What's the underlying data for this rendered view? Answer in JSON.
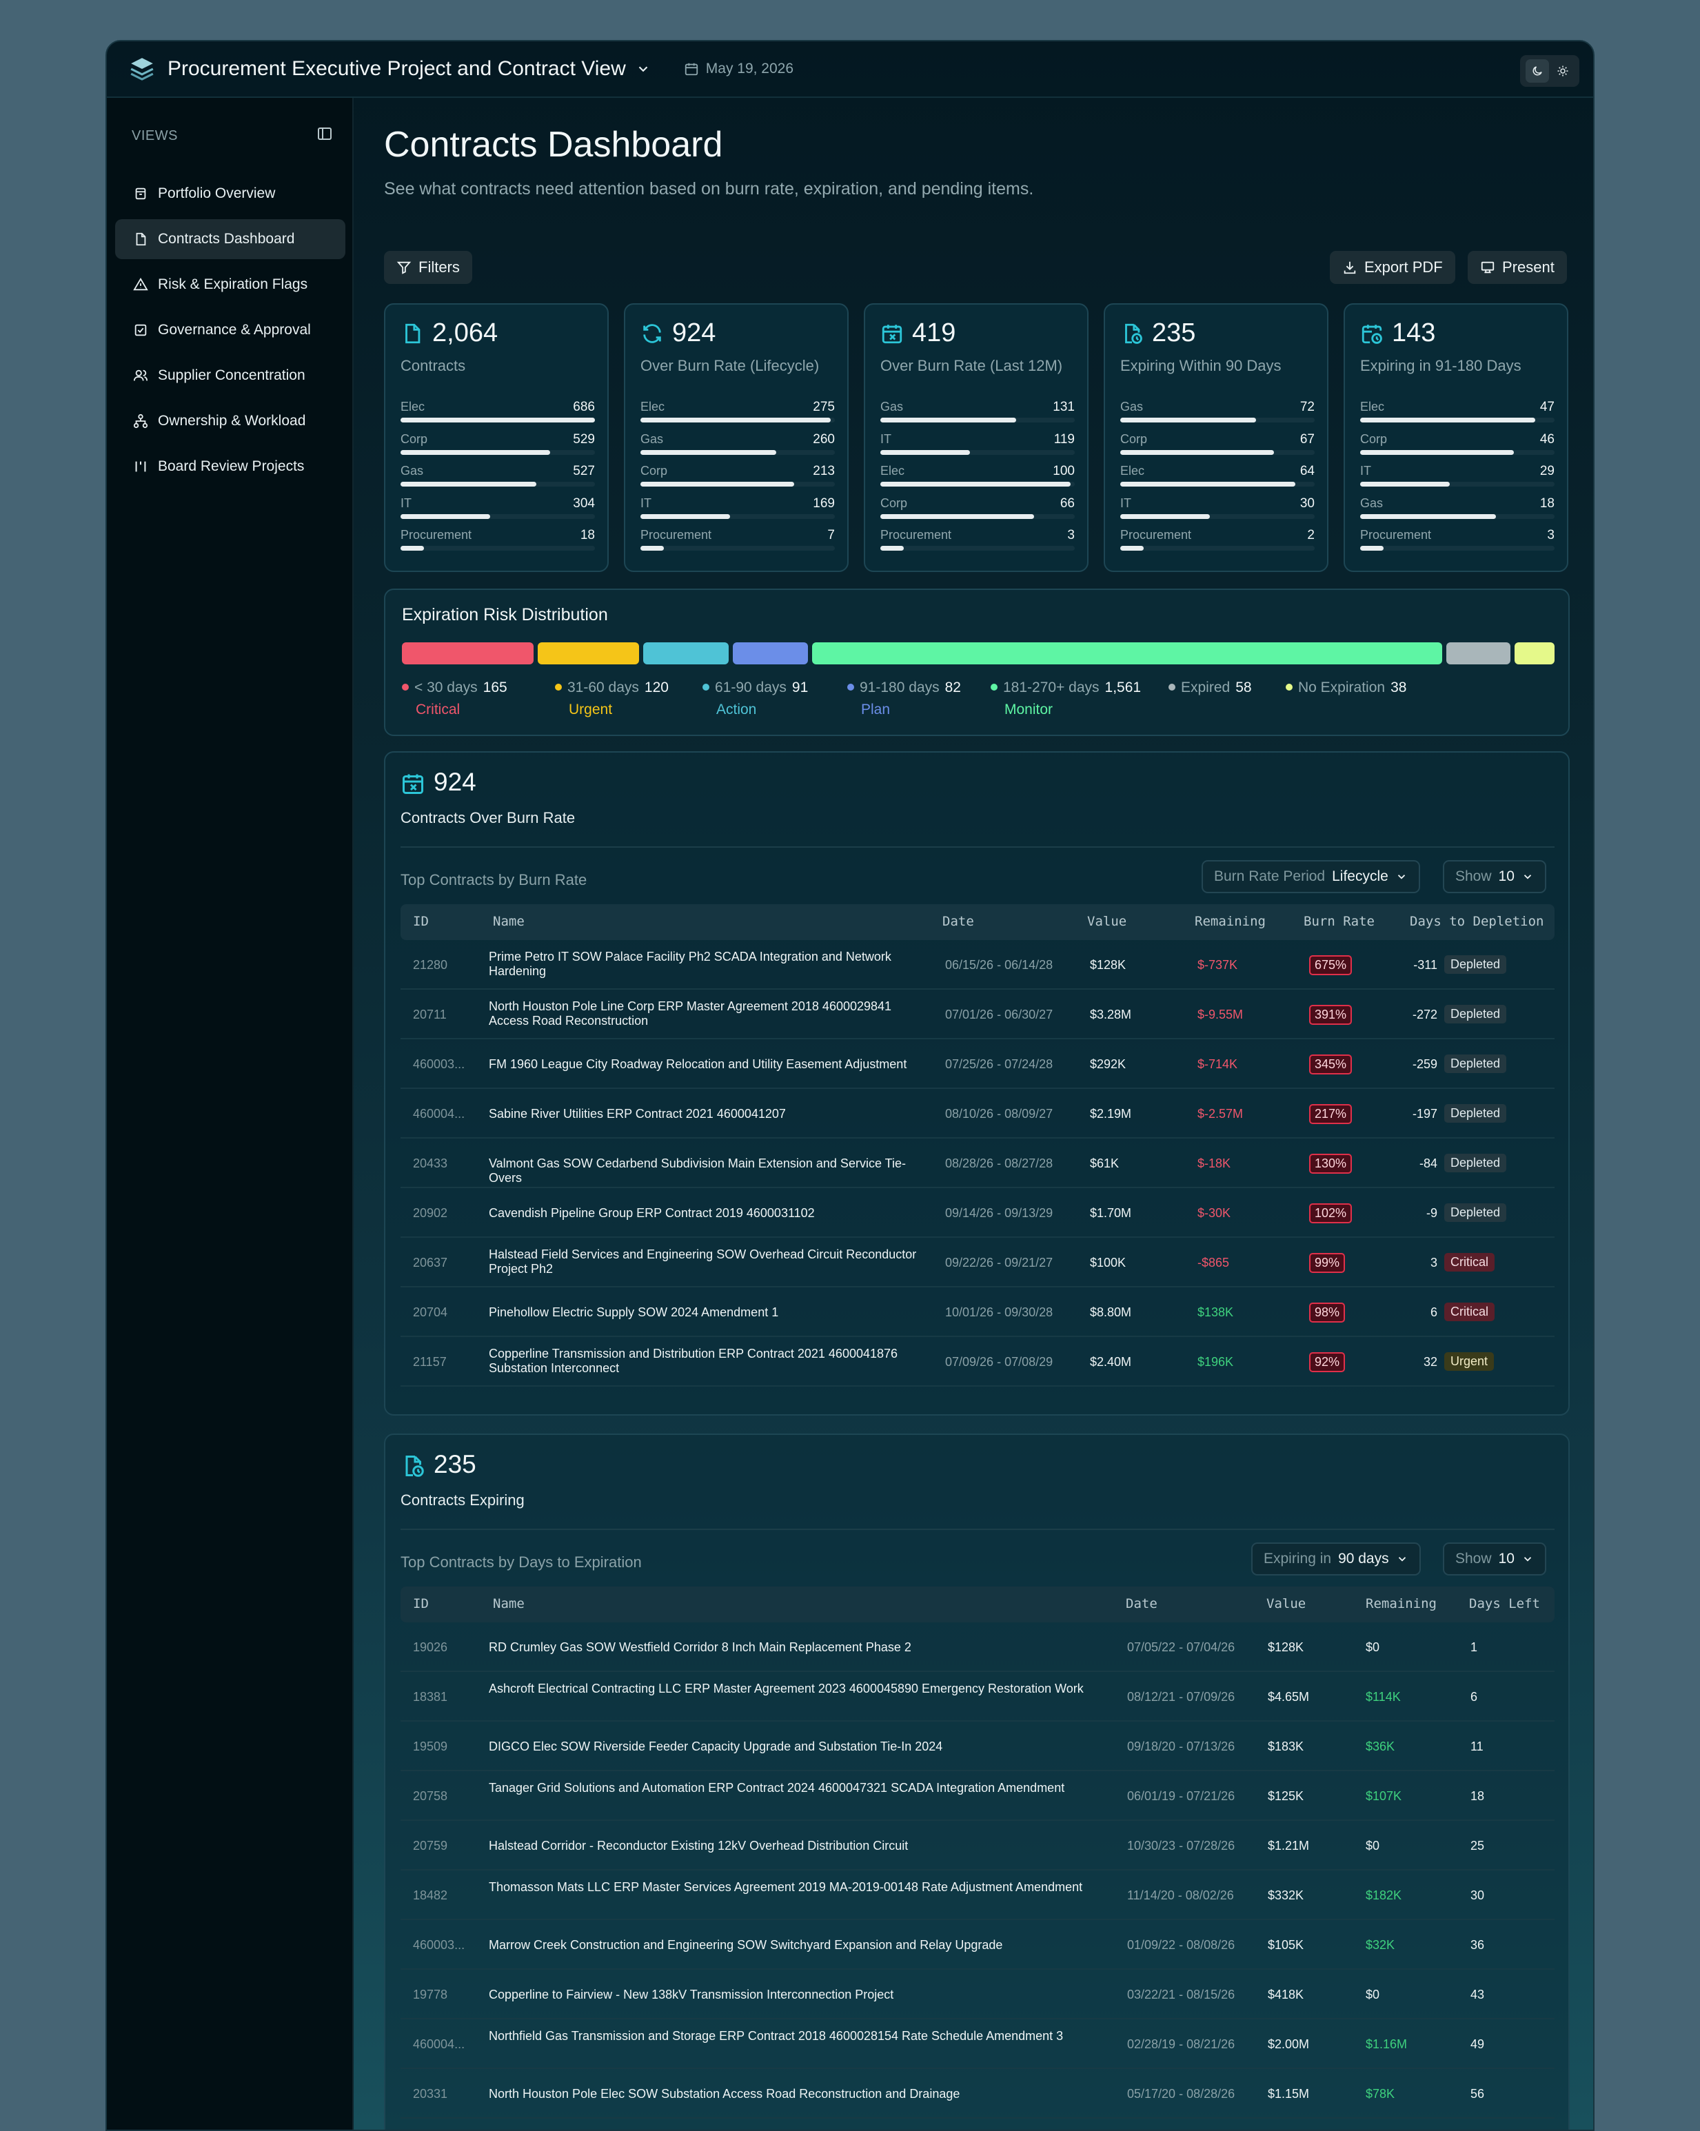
{
  "app": {
    "title": "Procurement Executive Project and Contract View",
    "date": "May 19, 2026"
  },
  "sidebar": {
    "heading": "VIEWS",
    "items": [
      {
        "label": "Portfolio Overview",
        "icon": "archive-icon"
      },
      {
        "label": "Contracts Dashboard",
        "icon": "file-icon",
        "active": true
      },
      {
        "label": "Risk & Expiration Flags",
        "icon": "warning-icon"
      },
      {
        "label": "Governance & Approval",
        "icon": "check-square-icon"
      },
      {
        "label": "Supplier Concentration",
        "icon": "users-icon"
      },
      {
        "label": "Ownership & Workload",
        "icon": "network-icon"
      },
      {
        "label": "Board Review Projects",
        "icon": "columns-icon"
      }
    ]
  },
  "page": {
    "title": "Contracts Dashboard",
    "subtitle": "See what contracts need attention based on burn rate, expiration, and pending items."
  },
  "toolbar": {
    "filters": "Filters",
    "export": "Export PDF",
    "present": "Present"
  },
  "kpis": [
    {
      "value": "2,064",
      "label": "Contracts",
      "icon": "file-icon",
      "rows": [
        {
          "n": "Elec",
          "v": "686",
          "f": 1.0
        },
        {
          "n": "Corp",
          "v": "529",
          "f": 0.77
        },
        {
          "n": "Gas",
          "v": "527",
          "f": 0.7
        },
        {
          "n": "IT",
          "v": "304",
          "f": 0.46
        },
        {
          "n": "Procurement",
          "v": "18",
          "f": 0.12
        }
      ]
    },
    {
      "value": "924",
      "label": "Over Burn Rate (Lifecycle)",
      "icon": "refresh-icon",
      "rows": [
        {
          "n": "Elec",
          "v": "275",
          "f": 0.98
        },
        {
          "n": "Gas",
          "v": "260",
          "f": 0.7
        },
        {
          "n": "Corp",
          "v": "213",
          "f": 0.79
        },
        {
          "n": "IT",
          "v": "169",
          "f": 0.46
        },
        {
          "n": "Procurement",
          "v": "7",
          "f": 0.12
        }
      ]
    },
    {
      "value": "419",
      "label": "Over Burn Rate (Last 12M)",
      "icon": "calendar-x-icon",
      "rows": [
        {
          "n": "Gas",
          "v": "131",
          "f": 0.7
        },
        {
          "n": "IT",
          "v": "119",
          "f": 0.46
        },
        {
          "n": "Elec",
          "v": "100",
          "f": 0.98
        },
        {
          "n": "Corp",
          "v": "66",
          "f": 0.79
        },
        {
          "n": "Procurement",
          "v": "3",
          "f": 0.12
        }
      ]
    },
    {
      "value": "235",
      "label": "Expiring Within 90 Days",
      "icon": "file-clock-icon",
      "rows": [
        {
          "n": "Gas",
          "v": "72",
          "f": 0.7
        },
        {
          "n": "Corp",
          "v": "67",
          "f": 0.79
        },
        {
          "n": "Elec",
          "v": "64",
          "f": 0.9
        },
        {
          "n": "IT",
          "v": "30",
          "f": 0.46
        },
        {
          "n": "Procurement",
          "v": "2",
          "f": 0.12
        }
      ]
    },
    {
      "value": "143",
      "label": "Expiring in 91-180 Days",
      "icon": "calendar-clock-icon",
      "rows": [
        {
          "n": "Elec",
          "v": "47",
          "f": 0.9
        },
        {
          "n": "Corp",
          "v": "46",
          "f": 0.79
        },
        {
          "n": "IT",
          "v": "29",
          "f": 0.46
        },
        {
          "n": "Gas",
          "v": "18",
          "f": 0.7
        },
        {
          "n": "Procurement",
          "v": "3",
          "f": 0.12
        }
      ]
    }
  ],
  "distribution": {
    "title": "Expiration Risk Distribution",
    "segments": [
      {
        "label": "< 30 days",
        "count": "165",
        "status": "Critical",
        "color": "#f0566b",
        "weight": 165
      },
      {
        "label": "31-60 days",
        "count": "120",
        "status": "Urgent",
        "color": "#f5c518",
        "weight": 120
      },
      {
        "label": "61-90 days",
        "count": "91",
        "status": "Action",
        "color": "#4fc3d6",
        "weight": 91
      },
      {
        "label": "91-180 days",
        "count": "82",
        "status": "Plan",
        "color": "#6b8ee8",
        "weight": 82
      },
      {
        "label": "181-270+ days",
        "count": "1,561",
        "status": "Monitor",
        "color": "#5ef5a4",
        "weight": 1561
      },
      {
        "label": "Expired",
        "count": "58",
        "status": "",
        "color": "#a9b6ba",
        "weight": 58
      },
      {
        "label": "No Expiration",
        "count": "38",
        "status": "",
        "color": "#e5f98a",
        "weight": 38
      }
    ]
  },
  "burn": {
    "count": "924",
    "label": "Contracts Over Burn Rate",
    "subtitle": "Top Contracts by Burn Rate",
    "period_label": "Burn Rate Period",
    "period_value": "Lifecycle",
    "show_label": "Show",
    "show_value": "10",
    "columns": [
      "ID",
      "Name",
      "Date",
      "Value",
      "Remaining",
      "Burn Rate",
      "Days to Depletion"
    ],
    "rows": [
      {
        "id": "21280",
        "name": "Prime Petro IT SOW Palace Facility Ph2 SCADA Integration and Network Hardening",
        "date": "06/15/26 - 06/14/28",
        "value": "$128K",
        "remaining": "$-737K",
        "rem_color": "red",
        "burn": "675%",
        "days": "-311",
        "status": "Depleted"
      },
      {
        "id": "20711",
        "name": "North Houston Pole Line Corp ERP Master Agreement 2018 4600029841 Access Road Reconstruction",
        "date": "07/01/26 - 06/30/27",
        "value": "$3.28M",
        "remaining": "$-9.55M",
        "rem_color": "red",
        "burn": "391%",
        "days": "-272",
        "status": "Depleted"
      },
      {
        "id": "460003...",
        "name": "FM 1960 League City Roadway Relocation and Utility Easement Adjustment",
        "date": "07/25/26 - 07/24/28",
        "value": "$292K",
        "remaining": "$-714K",
        "rem_color": "red",
        "burn": "345%",
        "days": "-259",
        "status": "Depleted"
      },
      {
        "id": "460004...",
        "name": "Sabine River Utilities ERP Contract 2021 4600041207",
        "date": "08/10/26 - 08/09/27",
        "value": "$2.19M",
        "remaining": "$-2.57M",
        "rem_color": "red",
        "burn": "217%",
        "days": "-197",
        "status": "Depleted"
      },
      {
        "id": "20433",
        "name": "Valmont Gas SOW Cedarbend Subdivision Main Extension and Service Tie-Overs",
        "date": "08/28/26 - 08/27/28",
        "value": "$61K",
        "remaining": "$-18K",
        "rem_color": "red",
        "burn": "130%",
        "days": "-84",
        "status": "Depleted"
      },
      {
        "id": "20902",
        "name": "Cavendish Pipeline Group ERP Contract 2019 4600031102",
        "date": "09/14/26 - 09/13/29",
        "value": "$1.70M",
        "remaining": "$-30K",
        "rem_color": "red",
        "burn": "102%",
        "days": "-9",
        "status": "Depleted"
      },
      {
        "id": "20637",
        "name": "Halstead Field Services and Engineering SOW Overhead Circuit Reconductor Project Ph2",
        "date": "09/22/26 - 09/21/27",
        "value": "$100K",
        "remaining": "-$865",
        "rem_color": "red",
        "burn": "99%",
        "days": "3",
        "status": "Critical"
      },
      {
        "id": "20704",
        "name": "Pinehollow Electric Supply SOW 2024 Amendment 1",
        "date": "10/01/26 - 09/30/28",
        "value": "$8.80M",
        "remaining": "$138K",
        "rem_color": "green",
        "burn": "98%",
        "days": "6",
        "status": "Critical"
      },
      {
        "id": "21157",
        "name": "Copperline Transmission and Distribution ERP Contract 2021 4600041876 Substation Interconnect",
        "date": "07/09/26 - 07/08/29",
        "value": "$2.40M",
        "remaining": "$196K",
        "rem_color": "green",
        "burn": "92%",
        "days": "32",
        "status": "Urgent"
      }
    ]
  },
  "expiring": {
    "count": "235",
    "label": "Contracts Expiring",
    "subtitle": "Top Contracts by Days to Expiration",
    "window_label": "Expiring in",
    "window_value": "90 days",
    "show_label": "Show",
    "show_value": "10",
    "columns": [
      "ID",
      "Name",
      "Date",
      "Value",
      "Remaining",
      "Days Left"
    ],
    "rows": [
      {
        "id": "19026",
        "name": "RD Crumley Gas SOW Westfield Corridor 8 Inch Main Replacement Phase 2",
        "date": "07/05/22 - 07/04/26",
        "value": "$128K",
        "remaining": "$0",
        "rem_color": "white",
        "days": "1"
      },
      {
        "id": "18381",
        "name": "Ashcroft Electrical Contracting LLC ERP Master Agreement 2023 4600045890 Emergency Restoration Work",
        "date": "08/12/21 - 07/09/26",
        "value": "$4.65M",
        "remaining": "$114K",
        "rem_color": "green",
        "days": "6"
      },
      {
        "id": "19509",
        "name": "DIGCO Elec SOW Riverside Feeder Capacity Upgrade and Substation Tie-In 2024",
        "date": "09/18/20 - 07/13/26",
        "value": "$183K",
        "remaining": "$36K",
        "rem_color": "green",
        "days": "11"
      },
      {
        "id": "20758",
        "name": "Tanager Grid Solutions and Automation ERP Contract 2024 4600047321 SCADA Integration Amendment",
        "date": "06/01/19 - 07/21/26",
        "value": "$125K",
        "remaining": "$107K",
        "rem_color": "green",
        "days": "18"
      },
      {
        "id": "20759",
        "name": "Halstead Corridor - Reconductor Existing 12kV Overhead Distribution Circuit",
        "date": "10/30/23 - 07/28/26",
        "value": "$1.21M",
        "remaining": "$0",
        "rem_color": "white",
        "days": "25"
      },
      {
        "id": "18482",
        "name": "Thomasson Mats LLC ERP Master Services Agreement 2019 MA-2019-00148 Rate Adjustment Amendment",
        "date": "11/14/20 - 08/02/26",
        "value": "$332K",
        "remaining": "$182K",
        "rem_color": "green",
        "days": "30"
      },
      {
        "id": "460003...",
        "name": "Marrow Creek Construction and Engineering SOW Switchyard Expansion and Relay Upgrade",
        "date": "01/09/22 - 08/08/26",
        "value": "$105K",
        "remaining": "$32K",
        "rem_color": "green",
        "days": "36"
      },
      {
        "id": "19778",
        "name": "Copperline to Fairview - New 138kV Transmission Interconnection Project",
        "date": "03/22/21 - 08/15/26",
        "value": "$418K",
        "remaining": "$0",
        "rem_color": "white",
        "days": "43"
      },
      {
        "id": "460004...",
        "name": "Northfield Gas Transmission and Storage ERP Contract 2018 4600028154 Rate Schedule Amendment 3",
        "date": "02/28/19 - 08/21/26",
        "value": "$2.00M",
        "remaining": "$1.16M",
        "rem_color": "green",
        "days": "49"
      },
      {
        "id": "20331",
        "name": "North Houston Pole Elec SOW Substation Access Road Reconstruction and Drainage",
        "date": "05/17/20 - 08/28/26",
        "value": "$1.15M",
        "remaining": "$78K",
        "rem_color": "green",
        "days": "56"
      }
    ]
  }
}
